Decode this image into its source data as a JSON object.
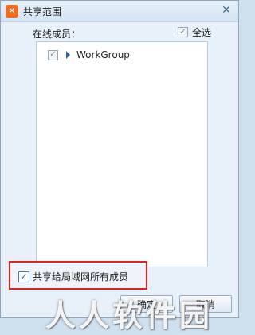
{
  "window": {
    "title": "共享范围",
    "app_icon": "app-logo-icon",
    "close_glyph": "✕"
  },
  "panel": {
    "online_members_label": "在线成员：",
    "select_all_label": "全选",
    "select_all_checked": true
  },
  "member_list": {
    "items": [
      {
        "label": "WorkGroup",
        "checked": true,
        "expanded": false
      }
    ]
  },
  "share_lan": {
    "label": "共享给局域网所有成员",
    "checked": true
  },
  "buttons": {
    "ok": "确定",
    "cancel": "取消"
  },
  "watermark": {
    "text": "人人软件园"
  },
  "colors": {
    "highlight_border": "#e0221f",
    "accent": "#f06b1c",
    "window_bg": "#e8f1fa"
  }
}
